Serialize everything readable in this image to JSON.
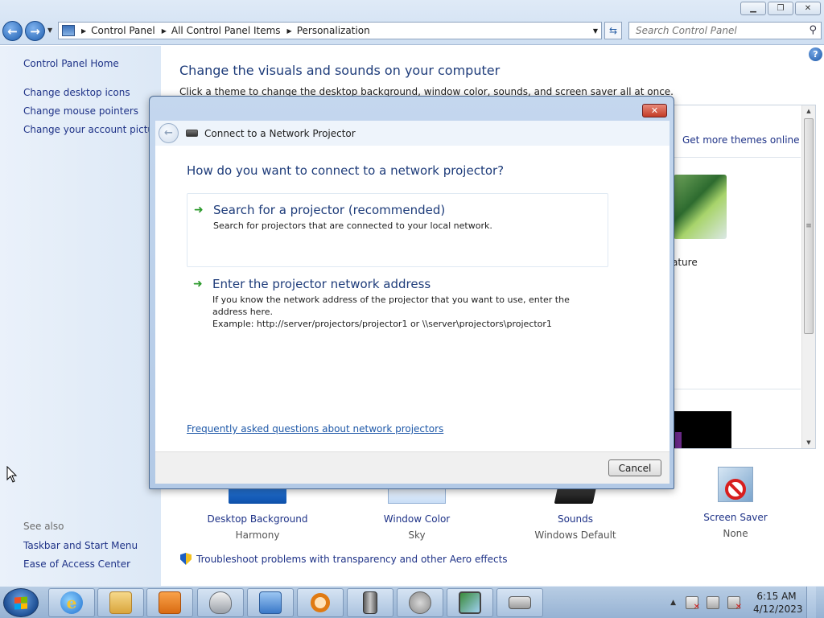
{
  "window": {
    "address": {
      "crumbs": [
        "Control Panel",
        "All Control Panel Items",
        "Personalization"
      ]
    },
    "search": {
      "placeholder": "Search Control Panel"
    }
  },
  "sidebar": {
    "home": "Control Panel Home",
    "links": [
      "Change desktop icons",
      "Change mouse pointers",
      "Change your account picture"
    ],
    "see_also_heading": "See also",
    "see_also": [
      "Taskbar and Start Menu",
      "Ease of Access Center"
    ]
  },
  "main": {
    "title": "Change the visuals and sounds on your computer",
    "subtitle": "Click a theme to change the desktop background, window color, sounds, and screen saver all at once.",
    "get_more_themes": "Get more themes online",
    "theme_label_partial": "ature",
    "bottom": [
      {
        "label": "Desktop Background",
        "value": "Harmony",
        "icon": "desktop-background-icon"
      },
      {
        "label": "Window Color",
        "value": "Sky",
        "icon": "window-color-icon"
      },
      {
        "label": "Sounds",
        "value": "Windows Default",
        "icon": "sounds-icon"
      },
      {
        "label": "Screen Saver",
        "value": "None",
        "icon": "screen-saver-icon"
      }
    ],
    "troubleshoot": "Troubleshoot problems with transparency and other Aero effects"
  },
  "dialog": {
    "title": "Connect to a Network Projector",
    "heading": "How do you want to connect to a network projector?",
    "options": [
      {
        "title": "Search for a projector (recommended)",
        "lines": [
          "Search for projectors that are connected to your local network."
        ]
      },
      {
        "title": "Enter the projector network address",
        "lines": [
          "If you know the network address of the projector that you want to use, enter the address here.",
          "Example: http://server/projectors/projector1 or \\\\server\\projectors\\projector1"
        ]
      }
    ],
    "faq_link": "Frequently asked questions about network projectors",
    "cancel": "Cancel"
  },
  "taskbar": {
    "apps": [
      "internet-explorer-icon",
      "windows-explorer-icon",
      "media-player-icon",
      "mouse-icon",
      "control-panel-icon",
      "search-icon",
      "server-icon",
      "speaker-icon",
      "display-icon",
      "projector-icon"
    ],
    "clock": {
      "time": "6:15 AM",
      "date": "4/12/2023"
    }
  },
  "colors": {
    "link": "#1e3287",
    "heading": "#1e3c7a",
    "arrow_green": "#2c9a2c",
    "close_red": "#c33b26"
  }
}
